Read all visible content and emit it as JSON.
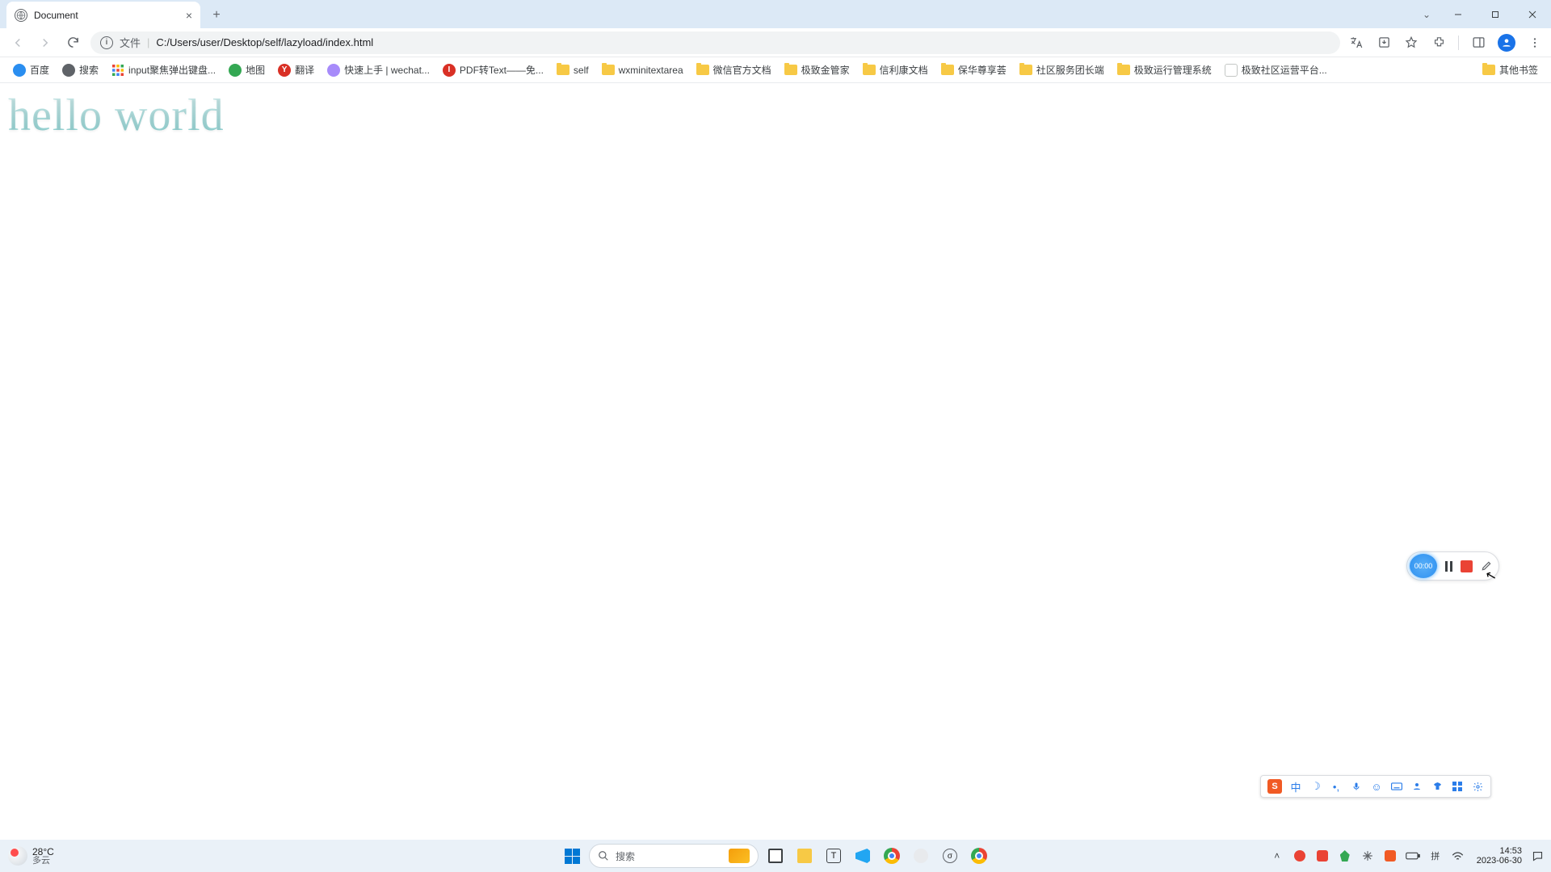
{
  "tab": {
    "title": "Document"
  },
  "omnibox": {
    "file_label": "文件",
    "url": "C:/Users/user/Desktop/self/lazyload/index.html"
  },
  "bookmarks": [
    {
      "label": "百度",
      "icon_bg": "#2a8ef0",
      "icon_txt": ""
    },
    {
      "label": "搜索",
      "icon_bg": "#5f6368",
      "icon_txt": ""
    },
    {
      "label": "input聚焦弹出键盘...",
      "icon_bg": "",
      "icon_txt": "",
      "grid": true
    },
    {
      "label": "地图",
      "icon_bg": "#34a853",
      "icon_txt": ""
    },
    {
      "label": "翻译",
      "icon_bg": "#d93025",
      "icon_txt": "Y"
    },
    {
      "label": "快速上手 | wechat...",
      "icon_bg": "#a78bfa",
      "icon_txt": ""
    },
    {
      "label": "PDF转Text——免...",
      "icon_bg": "#d93025",
      "icon_txt": "I"
    },
    {
      "label": "self",
      "folder": true
    },
    {
      "label": "wxminitextarea",
      "folder": true
    },
    {
      "label": "微信官方文档",
      "folder": true
    },
    {
      "label": "极致金管家",
      "folder": true
    },
    {
      "label": "信利康文档",
      "folder": true
    },
    {
      "label": "保华尊享荟",
      "folder": true
    },
    {
      "label": "社区服务团长端",
      "folder": true
    },
    {
      "label": "极致运行管理系统",
      "folder": true
    },
    {
      "label": "极致社区运营平台...",
      "icon_bg": "#ffffff",
      "icon_txt": "",
      "doc": true
    }
  ],
  "other_bookmarks_label": "其他书签",
  "page": {
    "hello_text": "hello world"
  },
  "recorder": {
    "time": "00:00"
  },
  "ime": {
    "lang": "中"
  },
  "taskbar": {
    "weather_temp": "28°C",
    "weather_desc": "多云",
    "search_placeholder": "搜索",
    "time": "14:53",
    "date": "2023-06-30"
  }
}
